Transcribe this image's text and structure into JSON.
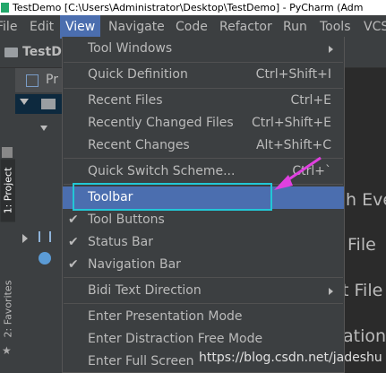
{
  "title": "TestDemo [C:\\Users\\Administrator\\Desktop\\TestDemo] - PyCharm (Adm",
  "menubar": [
    "File",
    "Edit",
    "View",
    "Navigate",
    "Code",
    "Refactor",
    "Run",
    "Tools",
    "VCS"
  ],
  "toolbar": {
    "crumb": "TestD"
  },
  "side_tabs": {
    "project": "1: Project",
    "favorites": "2: Favorites"
  },
  "project_header": "Pr",
  "editor_hints": [
    "h Eve",
    "File",
    "t File",
    "ation"
  ],
  "view_menu": {
    "items": [
      {
        "label": "Tool Windows",
        "submenu": true
      },
      {
        "label": "Quick Definition",
        "shortcut": "Ctrl+Shift+I"
      },
      {
        "label": "Recent Files",
        "shortcut": "Ctrl+E"
      },
      {
        "label": "Recently Changed Files",
        "shortcut": "Ctrl+Shift+E"
      },
      {
        "label": "Recent Changes",
        "shortcut": "Alt+Shift+C"
      },
      {
        "label": "Quick Switch Scheme...",
        "shortcut": "Ctrl+`"
      },
      {
        "label": "Toolbar",
        "selected": true
      },
      {
        "label": "Tool Buttons",
        "checked": true
      },
      {
        "label": "Status Bar",
        "checked": true
      },
      {
        "label": "Navigation Bar",
        "checked": true
      },
      {
        "label": "Bidi Text Direction",
        "submenu": true
      },
      {
        "label": "Enter Presentation Mode"
      },
      {
        "label": "Enter Distraction Free Mode"
      },
      {
        "label": "Enter Full Screen"
      }
    ]
  },
  "watermark": "https://blog.csdn.net/jadeshu",
  "colors": {
    "selection": "#4b6eaf",
    "highlight_box": "#22c7d6",
    "annotation_arrow": "#e040e0"
  }
}
